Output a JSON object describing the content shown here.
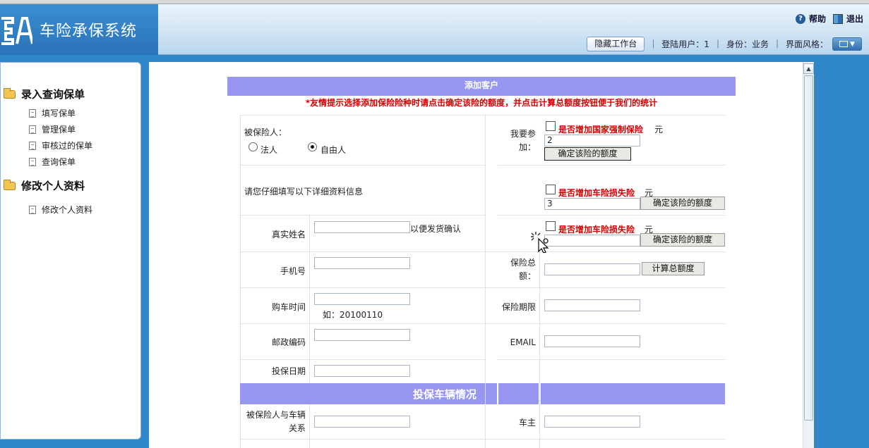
{
  "header": {
    "app_title": "车险承保系统",
    "help": "帮助",
    "exit": "退出",
    "hide_workbench": "隐藏工作台",
    "login_user": "登陆用户：1",
    "role": "身份：业务",
    "ui_style": "界面风格："
  },
  "sidebar": {
    "group1": "录入查询保单",
    "group1_items": [
      "填写保单",
      "管理保单",
      "审核过的保单",
      "查询保单"
    ],
    "group2": "修改个人资料",
    "group2_items": [
      "修改个人资料"
    ]
  },
  "form": {
    "title": "添加客户",
    "tip": "*友情提示选择添加保险险种时请点击确定该险的额度，并点击计算总额度按钮便于我们的统计",
    "insured_label": "被保险人：",
    "legal_person": "法人",
    "natural_person": "自由人",
    "detail_hint": "请您仔细填写以下详细资料信息",
    "real_name": "真实姓名",
    "real_name_suffix": "以便发货确认",
    "mobile": "手机号",
    "purchase_time": "购车时间",
    "purchase_time_example": "如：20100110",
    "postal_code": "邮政编码",
    "insure_date": "投保日期",
    "want_join": "我要参加：",
    "add_compulsory": "是否增加国家强制保险",
    "unit": "元",
    "compulsory_value": "2",
    "confirm_amount": "确定该险的额度",
    "add_damage": "是否增加车险损失险",
    "damage_value": "3",
    "add_damage2": "是否增加车险损失险",
    "total_label": "保险总额：",
    "calc_total": "计算总额度",
    "period": "保险期限",
    "email": "EMAIL",
    "vehicle_section": "投保车辆情况",
    "relation": "被保险人与车辆关系",
    "owner": "车主"
  },
  "colors": {
    "header_band": "#9797f1",
    "tip_red": "#d40000",
    "page_blue": "#2f86c9"
  }
}
